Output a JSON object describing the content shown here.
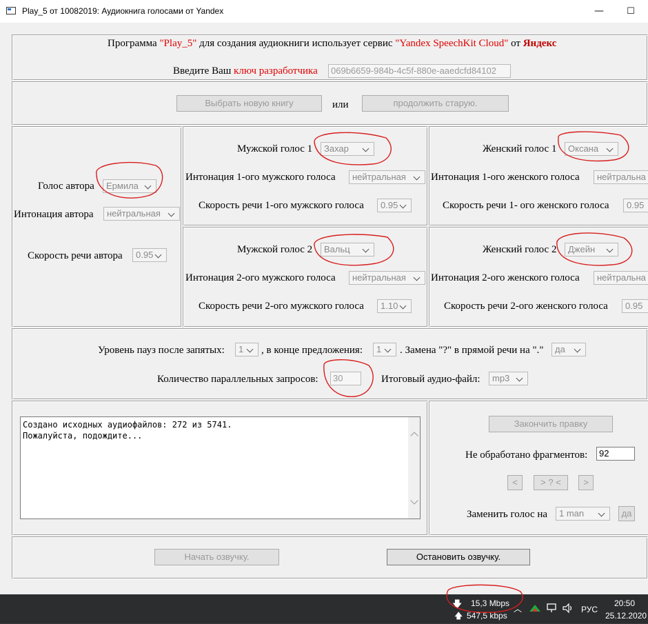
{
  "window": {
    "title": "Play_5 от 10082019: Аудиокнига голосами от Yandex",
    "minimize": "—",
    "maximize": "☐"
  },
  "intro": {
    "prefix": "Программа ",
    "program": "\"Play_5\"",
    "middle": " для создания аудиокниги использует сервис ",
    "service": "\"Yandex SpeechKit Cloud\"",
    "from": " от ",
    "brand": "Яндекс"
  },
  "key": {
    "label": "Введите Ваш ",
    "link": "ключ разработчика",
    "value": "069b6659-984b-4c5f-880e-aaedcfd84102"
  },
  "book": {
    "new_button": "Выбрать новую книгу",
    "or": "или",
    "continue_button": "продолжить  старую."
  },
  "author": {
    "voice_label": "Голос автора",
    "voice_value": "Ермила",
    "intonation_label": "Интонация автора",
    "intonation_value": "нейтральная",
    "speed_label": "Скорость речи автора",
    "speed_value": "0.95"
  },
  "male1": {
    "voice_label": "Мужской голос 1",
    "voice_value": "Захар",
    "intonation_label": "Интонация 1-ого мужского голоса",
    "intonation_value": "нейтральная",
    "speed_label": "Скорость речи 1-ого мужского голоса",
    "speed_value": "0.95"
  },
  "male2": {
    "voice_label": "Мужской голос 2",
    "voice_value": "Вальц",
    "intonation_label": "Интонация 2-ого мужского голоса",
    "intonation_value": "нейтральная",
    "speed_label": "Скорость речи 2-ого мужского голоса",
    "speed_value": "1.10"
  },
  "female1": {
    "voice_label": "Женский голос 1",
    "voice_value": "Оксана",
    "intonation_label": "Интонация 1-ого женского голоса",
    "intonation_value": "нейтральна",
    "speed_label": "Скорость речи 1- ого женского голоса",
    "speed_value": "0.95"
  },
  "female2": {
    "voice_label": "Женский голос 2",
    "voice_value": "Джейн",
    "intonation_label": "Интонация 2-ого женского голоса",
    "intonation_value": "нейтральна",
    "speed_label": "Скорость речи 2-ого женского голоса",
    "speed_value": "0.95"
  },
  "pauses": {
    "comma_label": "Уровень пауз после запятых:",
    "comma_value": "1",
    "sentence_label": ", в конце предложения:",
    "sentence_value": "1",
    "replace_label": ". Замена \"?\" в прямой речи на \".\"",
    "replace_value": "да",
    "parallel_label": "Количество параллельных запросов:",
    "parallel_value": "30",
    "output_label": "Итоговый аудио-файл:",
    "output_value": "mp3"
  },
  "log": {
    "line1": "Создано исходных аудиофайлов: 272 из 5741.",
    "line2": "Пожалуйста, подождите..."
  },
  "edit": {
    "finish_button": "Закончить правку",
    "unprocessed_label": "Не обработано фрагментов:",
    "unprocessed_value": "92",
    "prev_button": "<",
    "middle_button": "> ? <",
    "next_button": ">",
    "replace_label": "Заменить голос на",
    "replace_value": "1 man",
    "yes_button": "да"
  },
  "actions": {
    "start_button": "Начать озвучку.",
    "stop_button": "Остановить озвучку."
  },
  "taskbar": {
    "download": "15,3 Mbps",
    "upload": "547,5 kbps",
    "language": "РУС",
    "time": "20:50",
    "date": "25.12.2020"
  },
  "colors": {
    "accent_red": "#e00000",
    "annotation": "#d81e1e"
  }
}
